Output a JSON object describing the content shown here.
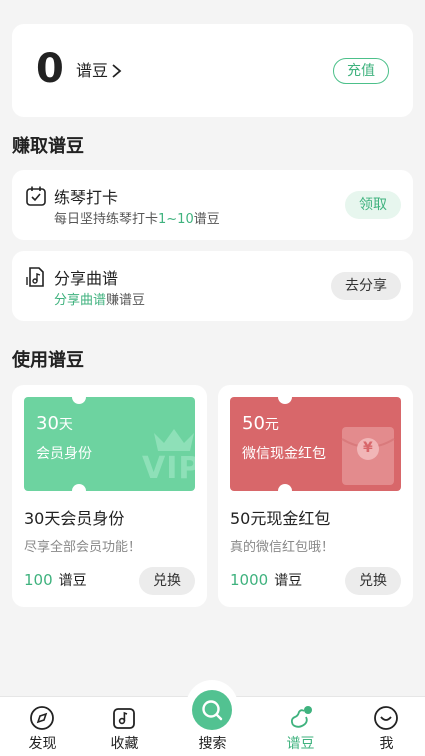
{
  "balance": {
    "amount": "0",
    "unit": "谱豆",
    "recharge_label": "充值"
  },
  "earn": {
    "title": "赚取谱豆",
    "tasks": [
      {
        "title": "练琴打卡",
        "desc_prefix": "每日坚持练琴打卡",
        "desc_highlight": "1~10",
        "desc_suffix": "谱豆",
        "action": "领取"
      },
      {
        "title": "分享曲谱",
        "desc_highlight": "分享曲谱",
        "desc_suffix": "赚谱豆",
        "action": "去分享"
      }
    ]
  },
  "use": {
    "title": "使用谱豆",
    "products": [
      {
        "ticket_big": "30",
        "ticket_big_unit": "天",
        "ticket_sub": "会员身份",
        "ticket_badge": "VIP",
        "name": "30天会员身份",
        "desc": "尽享全部会员功能！",
        "price": "100",
        "price_unit": "谱豆",
        "action": "兑换",
        "color": "#6dd3a0"
      },
      {
        "ticket_big": "50",
        "ticket_big_unit": "元",
        "ticket_sub": "微信现金红包",
        "ticket_badge": "¥",
        "name": "50元现金红包",
        "desc": "真的微信红包哦！",
        "price": "1000",
        "price_unit": "谱豆",
        "action": "兑换",
        "color": "#d8676a"
      }
    ]
  },
  "tabbar": {
    "items": [
      {
        "label": "发现",
        "icon": "compass-icon"
      },
      {
        "label": "收藏",
        "icon": "music-note-box-icon"
      },
      {
        "label": "搜索",
        "icon": "search-icon"
      },
      {
        "label": "谱豆",
        "icon": "bean-icon",
        "active": true
      },
      {
        "label": "我",
        "icon": "smile-face-icon"
      }
    ]
  },
  "colors": {
    "accent": "#3fb27e",
    "vip_ticket": "#6dd3a0",
    "cash_ticket": "#d8676a"
  }
}
